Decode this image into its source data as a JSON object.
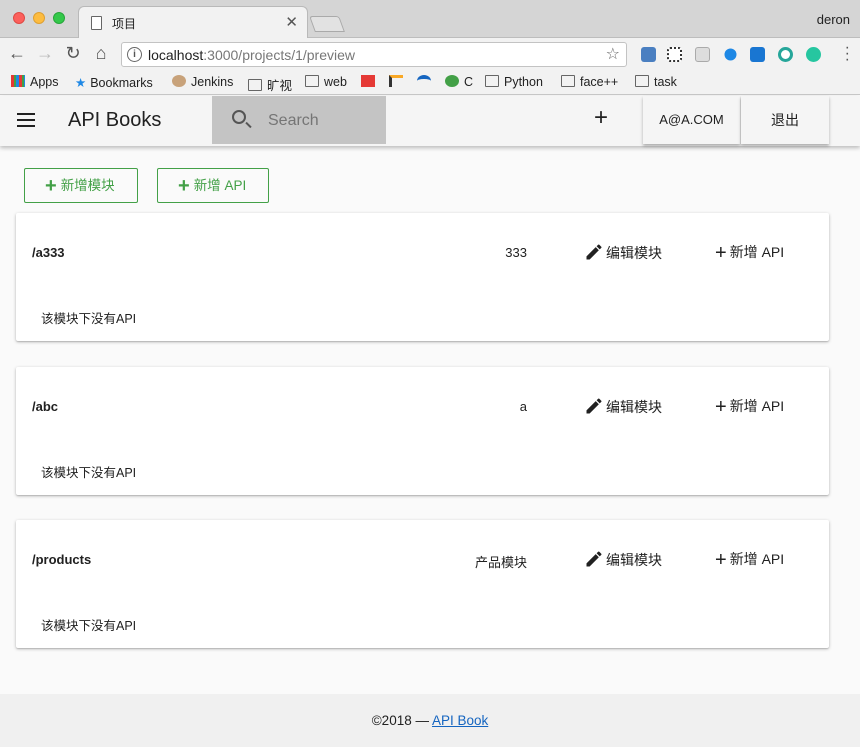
{
  "browser": {
    "tab_title": "项目",
    "profile_name": "deron",
    "url_host": "localhost",
    "url_rest": ":3000/projects/1/preview",
    "bookmarks": [
      "Apps",
      "Bookmarks",
      "Jenkins",
      "旷视",
      "web",
      "C",
      "Python",
      "face++",
      "task"
    ]
  },
  "header": {
    "title": "API Books",
    "search_placeholder": "Search",
    "add_icon": "+",
    "user": "A@A.COM",
    "logout": "退出"
  },
  "actions": {
    "add_module": "新增模块",
    "add_api": "新增 API"
  },
  "modules": [
    {
      "path": "/a333",
      "desc": "333",
      "edit": "编辑模块",
      "add_api": "新增 API",
      "empty": "该模块下没有API"
    },
    {
      "path": "/abc",
      "desc": "a",
      "edit": "编辑模块",
      "add_api": "新增 API",
      "empty": "该模块下没有API"
    },
    {
      "path": "/products",
      "desc": "产品模块",
      "edit": "编辑模块",
      "add_api": "新增 API",
      "empty": "该模块下没有API"
    }
  ],
  "footer": {
    "copyright": "©2018 — ",
    "link": "API Book"
  },
  "colors": {
    "accent_green": "#43a047",
    "link_blue": "#1565c0",
    "search_bg": "#c4c4c4"
  }
}
